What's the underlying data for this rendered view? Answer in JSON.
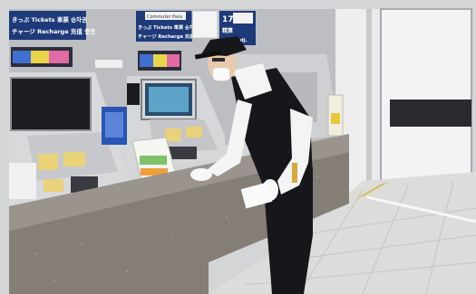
{
  "signs": {
    "left_line1": "きっぷ Tickets 車票 승차권",
    "left_line2": "チャージ Recharge 充值 충전",
    "center_line1": "きっぷ Tickets 車票 승차권",
    "center_line2": "チャージ Recharge 充值 충전",
    "right_number": "17",
    "right_line1": "精算",
    "right_line2": "Fare Adj.",
    "top_white_label": "Commuter Pass"
  },
  "colors": {
    "wall": "#c8c9cb",
    "sign_blue": "#1f3a7a",
    "counter": "#8a8580",
    "floor": "#d9d9d7",
    "uniform_vest": "#15161a",
    "shirt": "#f4f4f4",
    "machine_body": "#d7d8da"
  }
}
